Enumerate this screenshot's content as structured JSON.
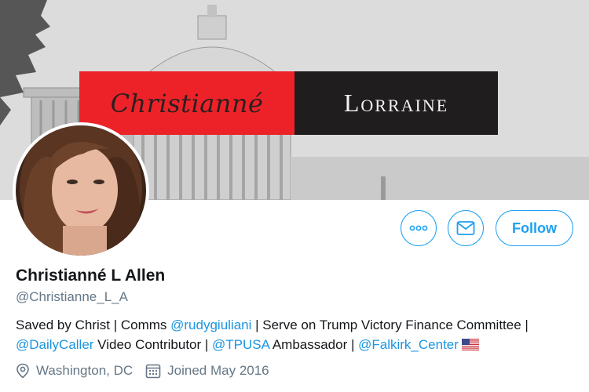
{
  "banner": {
    "logo_script": "Christianné",
    "logo_caps": "Lorraine",
    "colors": {
      "red": "#ed2229",
      "dark": "#1f1d1e"
    }
  },
  "avatar": {
    "icon": "profile-photo"
  },
  "actions": {
    "more_icon": "more-dots-icon",
    "message_icon": "envelope-icon",
    "follow_label": "Follow"
  },
  "profile": {
    "name": "Christianné L Allen",
    "handle": "@Christianne_L_A"
  },
  "bio": {
    "t1": "Saved by Christ | Comms ",
    "mention1": "@rudygiuliani",
    "t2": " | Serve on Trump Victory Finance Committee | ",
    "mention2": "@DailyCaller",
    "t3": " Video Contributor | ",
    "mention3": "@TPUSA",
    "t4": " Ambassador | ",
    "mention4": "@Falkirk_Center",
    "flag_icon": "us-flag-icon"
  },
  "meta": {
    "location": "Washington, DC",
    "joined": "Joined May 2016"
  },
  "colors": {
    "accent": "#1da1f2",
    "link": "#1b95e0",
    "secondary_text": "#657786"
  }
}
